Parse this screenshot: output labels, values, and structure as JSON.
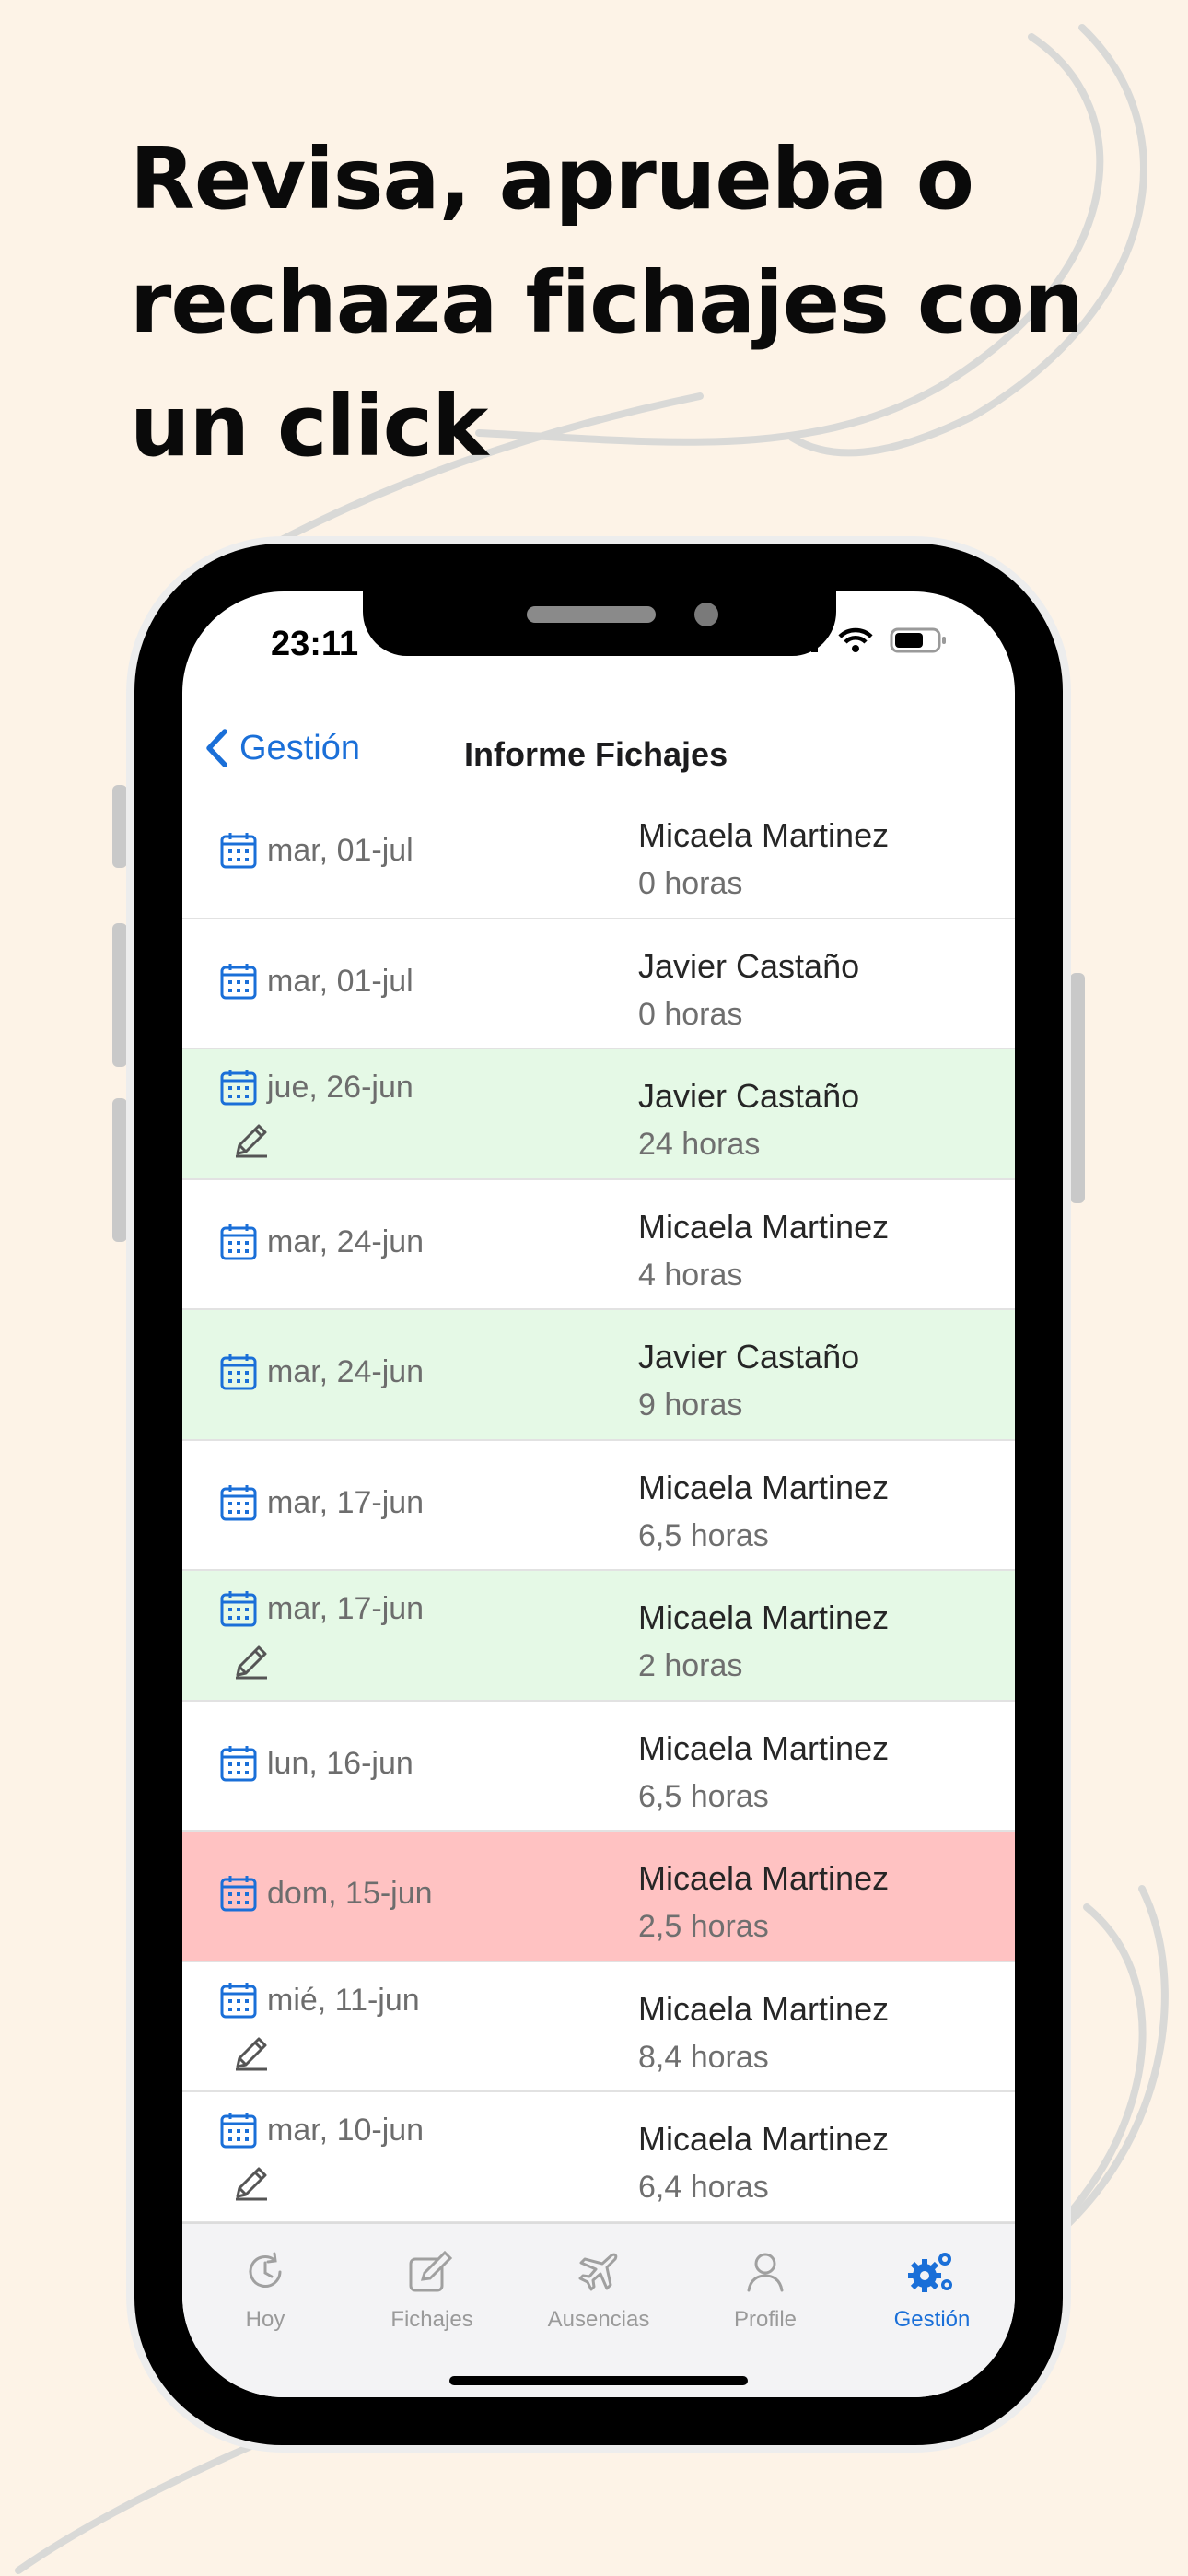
{
  "headline": [
    "Revisa, aprueba o",
    "rechaza fichajes con",
    "un click"
  ],
  "status_bar": {
    "time": "23:11"
  },
  "nav": {
    "back_label": "Gestión",
    "title": "Informe Fichajes"
  },
  "rows": [
    {
      "date": "mar, 01-jul",
      "name": "Micaela Martinez",
      "hours": "0 horas",
      "status": "default",
      "edited": false
    },
    {
      "date": "mar, 01-jul",
      "name": "Javier Castaño",
      "hours": "0 horas",
      "status": "default",
      "edited": false
    },
    {
      "date": "jue, 26-jun",
      "name": "Javier Castaño",
      "hours": "24 horas",
      "status": "approved",
      "edited": true
    },
    {
      "date": "mar, 24-jun",
      "name": "Micaela Martinez",
      "hours": "4 horas",
      "status": "default",
      "edited": false
    },
    {
      "date": "mar, 24-jun",
      "name": "Javier Castaño",
      "hours": "9 horas",
      "status": "approved",
      "edited": false
    },
    {
      "date": "mar, 17-jun",
      "name": "Micaela Martinez",
      "hours": "6,5 horas",
      "status": "default",
      "edited": false
    },
    {
      "date": "mar, 17-jun",
      "name": "Micaela Martinez",
      "hours": "2 horas",
      "status": "approved",
      "edited": true
    },
    {
      "date": "lun, 16-jun",
      "name": "Micaela Martinez",
      "hours": "6,5 horas",
      "status": "default",
      "edited": false
    },
    {
      "date": "dom, 15-jun",
      "name": "Micaela Martinez",
      "hours": "2,5 horas",
      "status": "rejected",
      "edited": false
    },
    {
      "date": "mié, 11-jun",
      "name": "Micaela Martinez",
      "hours": "8,4 horas",
      "status": "default",
      "edited": true
    },
    {
      "date": "mar, 10-jun",
      "name": "Micaela Martinez",
      "hours": "6,4 horas",
      "status": "default",
      "edited": true
    }
  ],
  "tabs": [
    {
      "label": "Hoy",
      "icon": "clock-refresh-icon",
      "active": false
    },
    {
      "label": "Fichajes",
      "icon": "edit-square-icon",
      "active": false
    },
    {
      "label": "Ausencias",
      "icon": "airplane-icon",
      "active": false
    },
    {
      "label": "Profile",
      "icon": "person-icon",
      "active": false
    },
    {
      "label": "Gestión",
      "icon": "gears-icon",
      "active": true
    }
  ],
  "colors": {
    "background": "#fdf3e7",
    "accent": "#1a6fd8",
    "approved_row": "#e5f9e6",
    "rejected_row": "#ffc2c2"
  }
}
